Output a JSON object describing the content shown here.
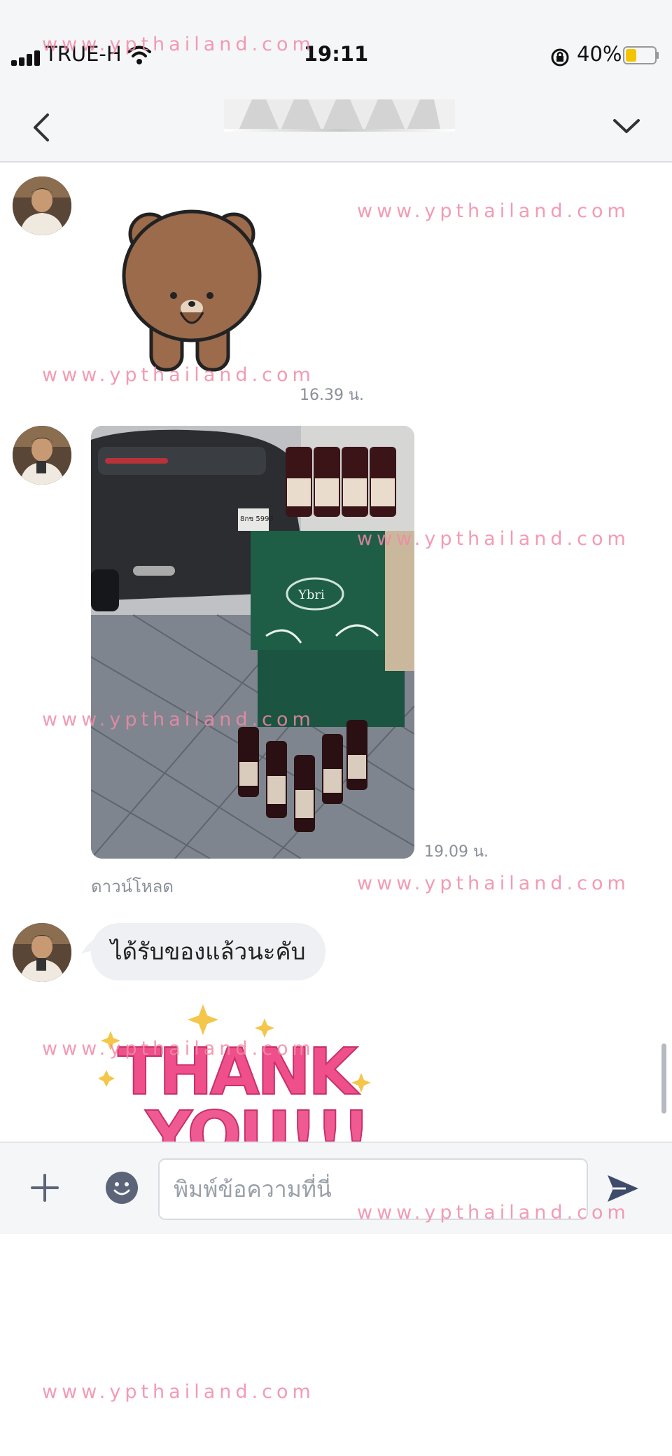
{
  "status_bar": {
    "carrier": "TRUE-H",
    "time": "19:11",
    "battery": "40%",
    "battery_level": 0.4
  },
  "header": {
    "title": ""
  },
  "messages": [
    {
      "type": "sticker",
      "sticker": "brown-bear-sticker",
      "time": "16.39 น."
    },
    {
      "type": "image",
      "image": "car-and-wine-boxes-photo",
      "time": "19.09 น.",
      "download_label": "ดาวน์โหลด"
    },
    {
      "type": "text",
      "text": "ได้รับของแล้วนะคับ"
    },
    {
      "type": "sticker",
      "sticker": "thank-you-sticker",
      "sticker_text": [
        "THANK",
        "YOU!!!"
      ]
    }
  ],
  "photo": {
    "box_logo": "Ybri",
    "plate": "8กช 5993"
  },
  "composer": {
    "placeholder": "พิมพ์ข้อความที่นี่"
  },
  "watermark": "www.ypthailand.com",
  "colors": {
    "watermark": "#f28aa6",
    "bubble": "#eef0f3",
    "bar": "#f5f6f8",
    "send": "#3f4b6b"
  }
}
